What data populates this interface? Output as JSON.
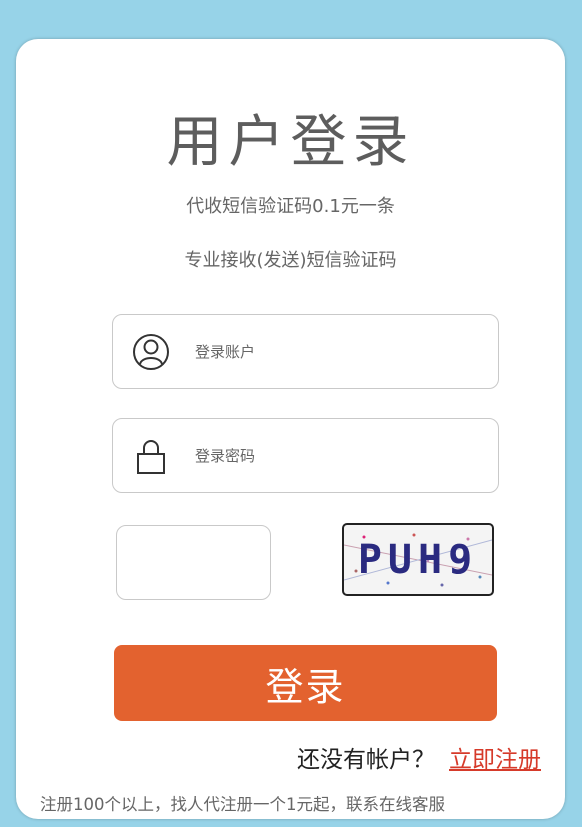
{
  "login": {
    "title": "用户登录",
    "subtitle_1": "代收短信验证码0.1元一条",
    "subtitle_2": "专业接收(发送)短信验证码",
    "account_placeholder": "登录账户",
    "password_placeholder": "登录密码",
    "captcha_text": "PUH9",
    "submit_label": "登录",
    "no_account_text": "还没有帐户？",
    "register_link": "立即注册",
    "footnote": "注册100个以上，找人代注册一个1元起，联系在线客服"
  },
  "colors": {
    "background": "#97d3e8",
    "button": "#e3622f",
    "link": "#d63a2a"
  },
  "icons": {
    "account": "user-icon",
    "password": "lock-icon"
  }
}
